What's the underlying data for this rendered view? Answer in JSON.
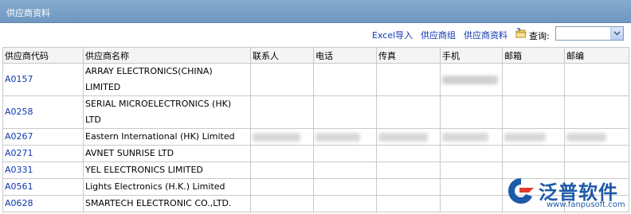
{
  "window": {
    "title": "供应商资料"
  },
  "toolbar": {
    "excel_import": "Excel导入",
    "supplier_group": "供应商组",
    "supplier_data": "供应商资料",
    "query_label": "查询:",
    "query_value": ""
  },
  "table": {
    "headers": [
      "供应商代码",
      "供应商名称",
      "联系人",
      "电话",
      "传真",
      "手机",
      "邮箱",
      "邮编"
    ],
    "rows": [
      {
        "code": "A0157",
        "name": "ARRAY ELECTRONICS(CHINA) LIMITED"
      },
      {
        "code": "A0258",
        "name": "SERIAL MICROELECTRONICS (HK) LTD"
      },
      {
        "code": "A0267",
        "name": "Eastern International (HK) Limited"
      },
      {
        "code": "A0271",
        "name": "AVNET SUNRISE LTD"
      },
      {
        "code": "A0331",
        "name": "YEL ELECTRONICS LIMITED"
      },
      {
        "code": "A0561",
        "name": "Lights Electronics (H.K.) Limited"
      },
      {
        "code": "A0628",
        "name": "SMARTECH ELECTRONIC CO.,LTD."
      }
    ]
  },
  "watermark": {
    "name": "泛普软件",
    "url": "www.fanpusoft.com"
  },
  "colors": {
    "link": "#1038b0",
    "titlebar": "#7ea3c9",
    "brand": "#1d5aa8"
  }
}
